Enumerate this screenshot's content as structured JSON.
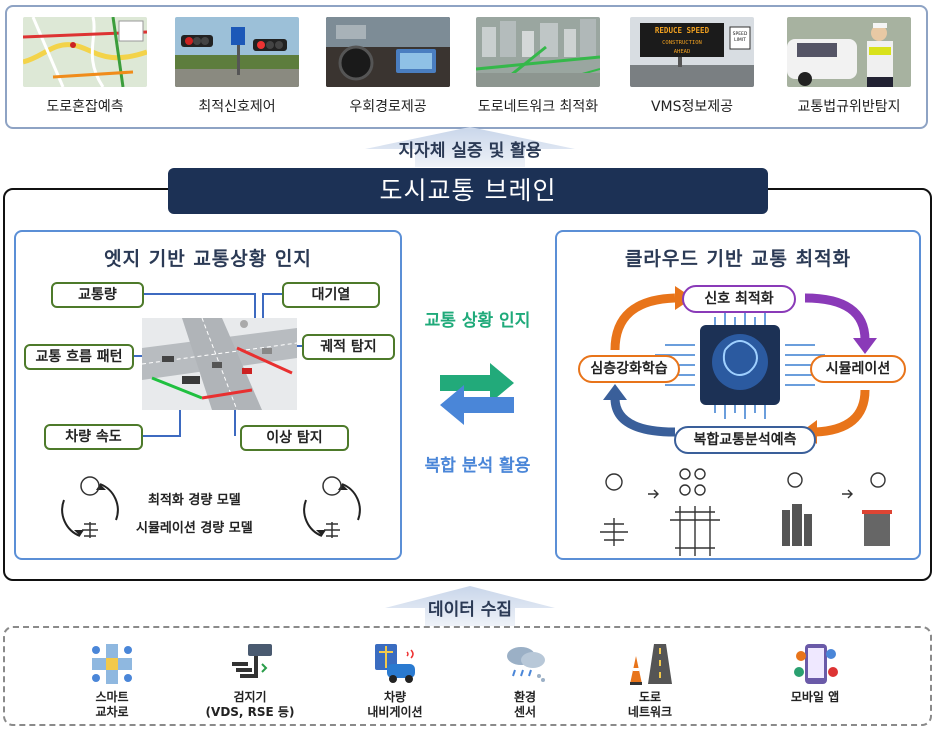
{
  "applications": {
    "section_label": "지자체 실증 및 활용",
    "items": [
      {
        "label": "도로혼잡예측",
        "icon": "traffic-map-thumbnail"
      },
      {
        "label": "최적신호제어",
        "icon": "traffic-signal-thumbnail"
      },
      {
        "label": "우회경로제공",
        "icon": "car-navigation-thumbnail"
      },
      {
        "label": "도로네트워크 최적화",
        "icon": "city-road-network-thumbnail"
      },
      {
        "label": "VMS정보제공",
        "icon": "vms-sign-thumbnail",
        "sign_text": [
          "REDUCE SPEED",
          "CONSTRUCTION",
          "AHEAD"
        ],
        "side_sign": [
          "SPEED",
          "LIMIT"
        ]
      },
      {
        "label": "교통법규위반탐지",
        "icon": "police-enforcement-thumbnail"
      }
    ]
  },
  "brain": {
    "title": "도시교통 브레인",
    "edge_panel": {
      "title": "엣지 기반 교통상황 인지",
      "labels": {
        "traffic_volume": "교통량",
        "queue": "대기열",
        "flow_pattern": "교통 흐름 패턴",
        "trajectory": "궤적 탐지",
        "vehicle_speed": "차량 속도",
        "anomaly": "이상 탐지"
      },
      "model_lines": [
        "최적화 경량 모델",
        "시뮬레이션 경량 모델"
      ]
    },
    "center": {
      "top_label": "교통 상황 인지",
      "bottom_label": "복합 분석 활용",
      "top_color": "#1faa7a",
      "bottom_color": "#4a86d8"
    },
    "cloud_panel": {
      "title": "클라우드 기반 교통 최적화",
      "cycle": {
        "top": "신호 최적화",
        "right": "시뮬레이션",
        "bottom": "복합교통분석예측",
        "left": "심층강화학습"
      },
      "arrow_colors": {
        "purple": "#8a3ab8",
        "orange": "#e8741a",
        "blue": "#3a5f9a"
      }
    }
  },
  "data_collection": {
    "section_label": "데이터 수집",
    "items": [
      {
        "label": "스마트\n교차로",
        "icon": "smart-intersection-icon"
      },
      {
        "label": "검지기\n(VDS, RSE 등)",
        "icon": "detector-camera-icon"
      },
      {
        "label": "차량\n내비게이션",
        "icon": "vehicle-navigation-icon"
      },
      {
        "label": "환경\n센서",
        "icon": "weather-sensor-icon"
      },
      {
        "label": "도로\n네트워크",
        "icon": "road-network-icon"
      },
      {
        "label": "모바일 앱",
        "icon": "mobile-app-icon"
      }
    ]
  },
  "colors": {
    "navy": "#1c3155",
    "panel_border": "#5b8fd6",
    "pill_border": "#4d7a2a"
  }
}
